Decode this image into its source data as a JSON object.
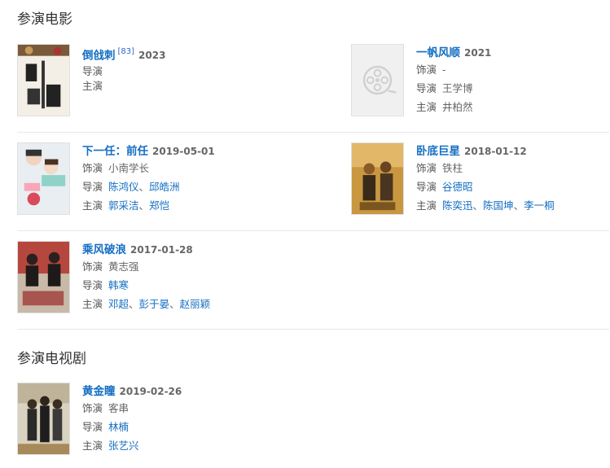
{
  "sections": {
    "movies": {
      "title": "参演电影"
    },
    "tv": {
      "title": "参演电视剧"
    }
  },
  "labels": {
    "role": "饰演",
    "director": "导演",
    "star": "主演"
  },
  "movies": [
    {
      "title": "倒戗刺",
      "sup": "[83]",
      "date": "2023",
      "role": "",
      "director": "",
      "stars": ""
    },
    {
      "title": "一帆风顺",
      "date": "2021",
      "role": "-",
      "director": "王学博",
      "stars": "井柏然"
    },
    {
      "title": "下一任：前任",
      "date": "2019-05-01",
      "role": "小南学长",
      "directors": [
        "陈鸿仪",
        "邱皓洲"
      ],
      "stars": [
        "郭采洁",
        "郑恺"
      ]
    },
    {
      "title": "卧底巨星",
      "date": "2018-01-12",
      "role": "铁柱",
      "directors": [
        "谷德昭"
      ],
      "stars": [
        "陈奕迅",
        "陈国坤",
        "李一桐"
      ]
    },
    {
      "title": "乘风破浪",
      "date": "2017-01-28",
      "role": "黄志强",
      "directors": [
        "韩寒"
      ],
      "stars": [
        "邓超",
        "彭于晏",
        "赵丽颖"
      ]
    }
  ],
  "tv": [
    {
      "title": "黄金瞳",
      "date": "2019-02-26",
      "role": "客串",
      "directors": [
        "林楠"
      ],
      "stars": [
        "张艺兴"
      ]
    }
  ],
  "icons": {
    "placeholder": "film-reel-icon"
  },
  "colors": {
    "link": "#136ec2",
    "divider": "#e8e8e8"
  }
}
